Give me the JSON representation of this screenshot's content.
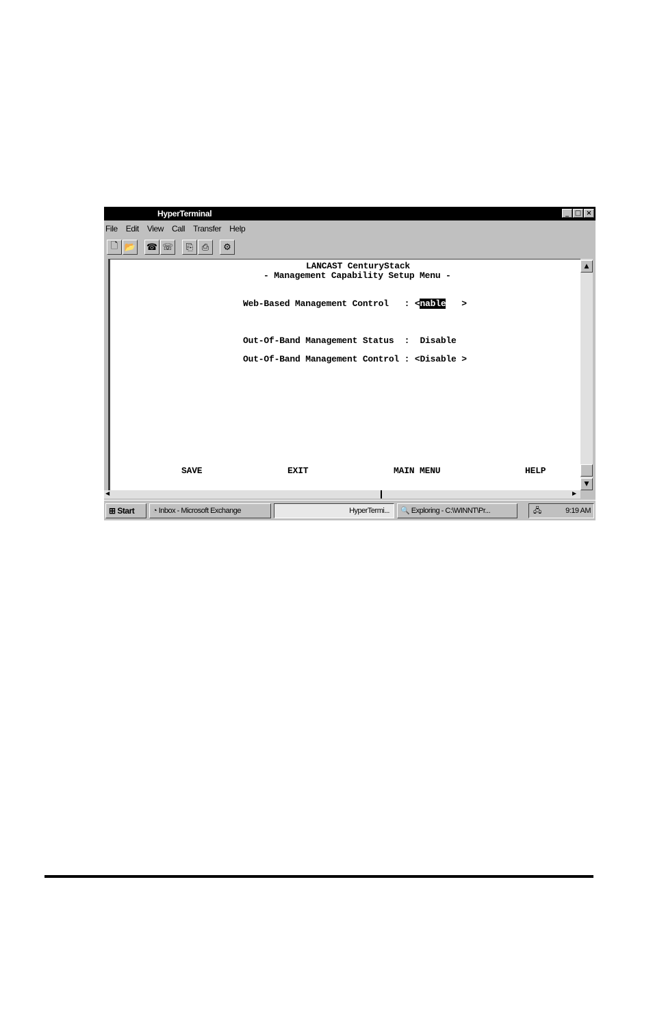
{
  "window": {
    "title": "HyperTerminal",
    "btn_min": "_",
    "btn_max": "□",
    "btn_close": "×"
  },
  "menu": [
    "File",
    "Edit",
    "View",
    "Call",
    "Transfer",
    "Help"
  ],
  "icons": {
    "new": "🗋",
    "open": "📂",
    "connect": "☎",
    "disconnect": "☏",
    "send": "⎘",
    "receive": "⎙",
    "properties": "⚙"
  },
  "terminal": {
    "heading1": "LANCAST CenturyStack",
    "heading2": "- Management Capability Setup Menu -",
    "web_label": "Web-Based Management Control   : <",
    "web_value": "nable",
    "web_end": "   >",
    "oob_status": "Out-Of-Band Management Status  :  Disable",
    "oob_control": "Out-Of-Band Management Control : <Disable >",
    "actions": [
      "SAVE",
      "EXIT",
      "MAIN MENU",
      "HELP"
    ]
  },
  "taskbar": {
    "start": "Start",
    "items": [
      "Inbox - Microsoft Exchange",
      "HyperTermi...",
      "Exploring - C:\\WINNT\\Pr..."
    ],
    "clock": "9:19 AM"
  }
}
